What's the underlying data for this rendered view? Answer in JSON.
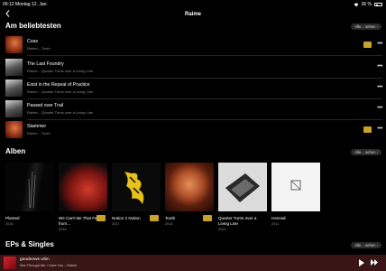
{
  "status": {
    "time": "09:12",
    "date": "Montag 12. Jan.",
    "battery": "36 %"
  },
  "nav": {
    "back_icon": "chevron-left-icon",
    "title": "Raime"
  },
  "top_songs": {
    "title": "Am beliebtesten",
    "see_all": "Alle... sehen ›",
    "items": [
      {
        "title": "Coax",
        "subtitle": "Raime – Tooth",
        "badge": true
      },
      {
        "title": "The Last Foundry",
        "subtitle": "Raime – Quarter Turns over a Living Line",
        "badge": false
      },
      {
        "title": "Exist in the Repeat of Practice",
        "subtitle": "Raime – Quarter Turns over a Living Line",
        "badge": false
      },
      {
        "title": "Passed over Trail",
        "subtitle": "Raime – Quarter Turns over a Living Line",
        "badge": false
      },
      {
        "title": "Stammer",
        "subtitle": "Raime – Tooth",
        "badge": true
      }
    ]
  },
  "albums": {
    "title": "Alben",
    "see_all": "Alle... sehen ›",
    "items": [
      {
        "title": "Planted",
        "year": "2016",
        "badge": false
      },
      {
        "title": "We Can't Be That Far from...",
        "year": "2018",
        "badge": true
      },
      {
        "title": "Notion 2 Notion",
        "year": "2017",
        "badge": true
      },
      {
        "title": "Tooth",
        "year": "2016",
        "badge": true
      },
      {
        "title": "Quarter Turns over a Living Line",
        "year": "2012",
        "badge": false
      },
      {
        "title": "Hennail",
        "year": "2011",
        "badge": false
      }
    ]
  },
  "eps": {
    "title": "EPs & Singles",
    "see_all": "Alle... sehen ›"
  },
  "player": {
    "title": "goodnews wlim",
    "subtitle": "See Through Me, I Dare You – Raime"
  }
}
